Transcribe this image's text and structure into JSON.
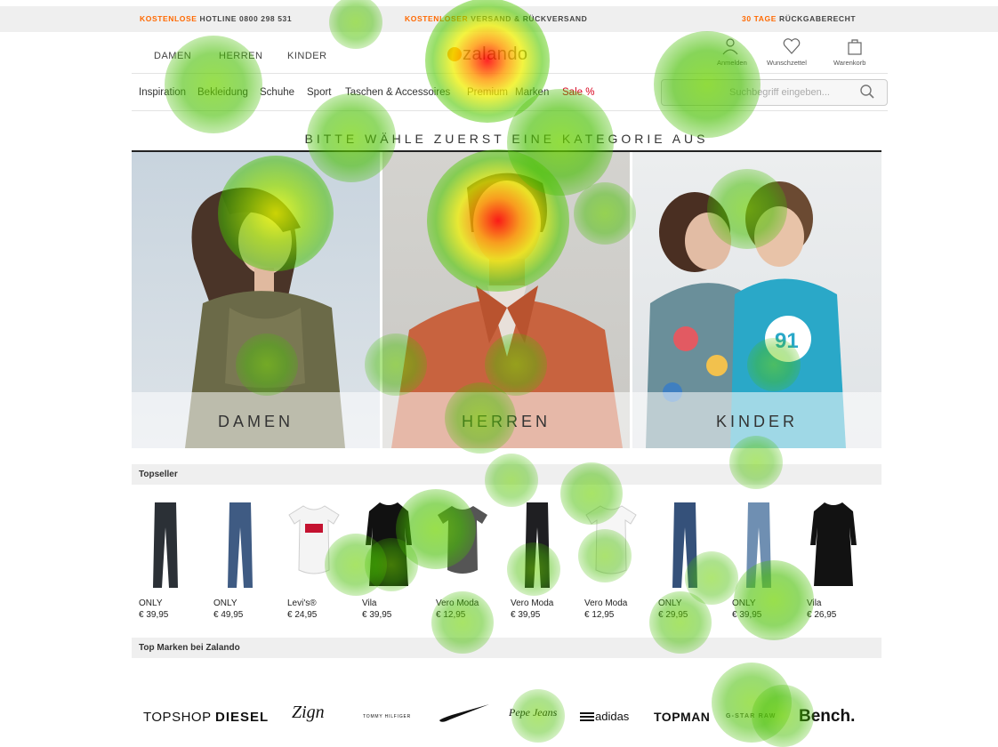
{
  "topbar": {
    "hotline_prefix": "KOSTENLOSE",
    "hotline_rest": " HOTLINE 0800 298 531",
    "shipping_prefix": "KOSTENLOSER",
    "shipping_rest": " VERSAND & RÜCKVERSAND",
    "return_prefix": "30 TAGE",
    "return_rest": " RÜCKGABERECHT"
  },
  "header": {
    "genders": [
      "DAMEN",
      "HERREN",
      "KINDER"
    ],
    "logo": "zalando",
    "icons": [
      {
        "icon": "user-icon",
        "label": "Anmelden"
      },
      {
        "icon": "heart-icon",
        "label": "Wunschzettel"
      },
      {
        "icon": "bag-icon",
        "label": "Warenkorb"
      }
    ]
  },
  "nav": {
    "items": [
      "Inspiration",
      "Bekleidung",
      "Schuhe",
      "Sport",
      "Taschen & Accessoires",
      "Premium",
      "Marken",
      "Sale %"
    ]
  },
  "search": {
    "placeholder": "Suchbegriff eingeben..."
  },
  "categories": {
    "heading": "BITTE WÄHLE ZUERST EINE KATEGORIE AUS",
    "tiles": [
      "DAMEN",
      "HERREN",
      "KINDER"
    ]
  },
  "topseller": {
    "title": "Topseller",
    "products": [
      {
        "brand": "ONLY",
        "price": "€ 39,95",
        "kind": "jeans",
        "color": "#2b3036"
      },
      {
        "brand": "ONLY",
        "price": "€ 49,95",
        "kind": "jeans",
        "color": "#3f5b83"
      },
      {
        "brand": "Levi's®",
        "price": "€ 24,95",
        "kind": "tee",
        "color": "#f4f4f4"
      },
      {
        "brand": "Vila",
        "price": "€ 39,95",
        "kind": "dress",
        "color": "#111111"
      },
      {
        "brand": "Vero Moda",
        "price": "€ 12,95",
        "kind": "tee",
        "color": "#555555"
      },
      {
        "brand": "Vero Moda",
        "price": "€ 39,95",
        "kind": "jeans",
        "color": "#1f1f22"
      },
      {
        "brand": "Vero Moda",
        "price": "€ 12,95",
        "kind": "tee",
        "color": "#f6f6f6"
      },
      {
        "brand": "ONLY",
        "price": "€ 29,95",
        "kind": "jeans",
        "color": "#35517a"
      },
      {
        "brand": "ONLY",
        "price": "€ 39,95",
        "kind": "jeans",
        "color": "#6f8fb2"
      },
      {
        "brand": "Vila",
        "price": "€ 26,95",
        "kind": "dress",
        "color": "#121212"
      }
    ]
  },
  "brands": {
    "title": "Top Marken bei Zalando",
    "items": [
      "TOPSHOP",
      "DIESEL",
      "Zign",
      "TOMMY HILFIGER",
      "Nike",
      "Pepe Jeans",
      "adidas",
      "TOPMAN",
      "G-STAR RAW",
      "Bench."
    ]
  }
}
